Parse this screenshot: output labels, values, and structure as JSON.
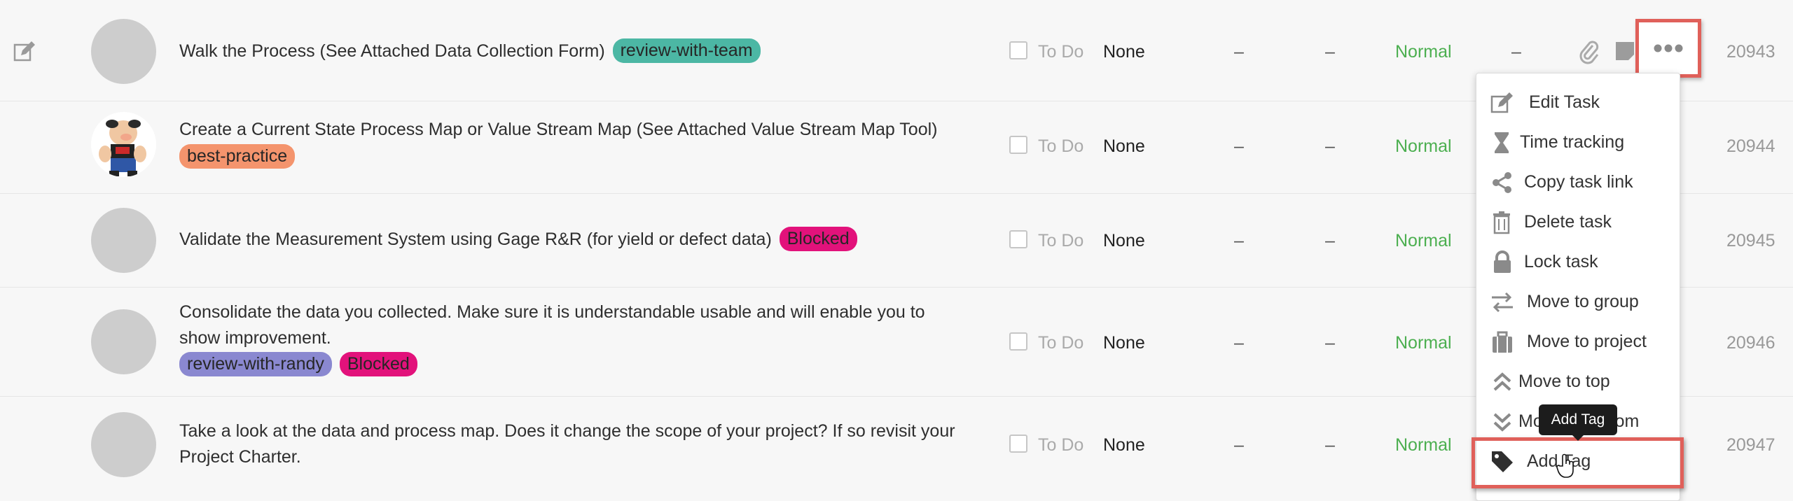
{
  "columns": {
    "none": "None",
    "dash": "–"
  },
  "tasks": [
    {
      "title": "Walk the Process (See Attached Data Collection Form)",
      "tags": [
        "review-with-team"
      ],
      "status": "To Do",
      "assignee": "None",
      "col1": "–",
      "col2": "–",
      "priority": "Normal",
      "extra": "–",
      "id": "20943",
      "avatar": "blank"
    },
    {
      "title": "Create a Current State Process Map or Value Stream Map (See Attached Value Stream Map Tool)",
      "tags": [
        "best-practice"
      ],
      "status": "To Do",
      "assignee": "None",
      "col1": "–",
      "col2": "–",
      "priority": "Normal",
      "id": "20944",
      "avatar": "cartoon-sailor"
    },
    {
      "title": "Validate the Measurement System using Gage R&R (for yield or defect data)",
      "tags": [
        "Blocked"
      ],
      "status": "To Do",
      "assignee": "None",
      "col1": "–",
      "col2": "–",
      "priority": "Normal",
      "id": "20945",
      "avatar": "blank"
    },
    {
      "title_line1": "Consolidate the data you collected. Make sure it is understandable usable and will enable you to",
      "title_line2": "show improvement.",
      "tags": [
        "review-with-randy",
        "Blocked"
      ],
      "status": "To Do",
      "assignee": "None",
      "col1": "–",
      "col2": "–",
      "priority": "Normal",
      "id": "20946",
      "avatar": "blank"
    },
    {
      "title_line1": "Take a look at the data and process map. Does it change the scope of your project? If so revisit your",
      "title_line2": "Project Charter.",
      "tags": [],
      "status": "To Do",
      "assignee": "None",
      "col1": "–",
      "col2": "–",
      "priority": "Normal",
      "id": "20947",
      "avatar": "blank"
    }
  ],
  "menu": {
    "items": [
      {
        "label": "Edit Task",
        "icon": "edit-icon"
      },
      {
        "label": "Time tracking",
        "icon": "hourglass-icon"
      },
      {
        "label": "Copy task link",
        "icon": "share-icon"
      },
      {
        "label": "Delete task",
        "icon": "trash-icon"
      },
      {
        "label": "Lock task",
        "icon": "lock-icon"
      },
      {
        "label": "Move to group",
        "icon": "swap-icon"
      },
      {
        "label": "Move to project",
        "icon": "briefcase-icon"
      },
      {
        "label": "Move to top",
        "icon": "double-up-icon"
      },
      {
        "label": "Move to bottom",
        "icon": "double-down-icon"
      },
      {
        "label": "Add Tag",
        "icon": "tag-icon"
      }
    ],
    "tooltip": "Add Tag"
  },
  "colors": {
    "teal": "#4cb7a4",
    "orange": "#f4946d",
    "pink": "#e2127b",
    "purple": "#8a88d0",
    "priority_green": "#4caf50",
    "highlight_red": "#e0605a"
  }
}
